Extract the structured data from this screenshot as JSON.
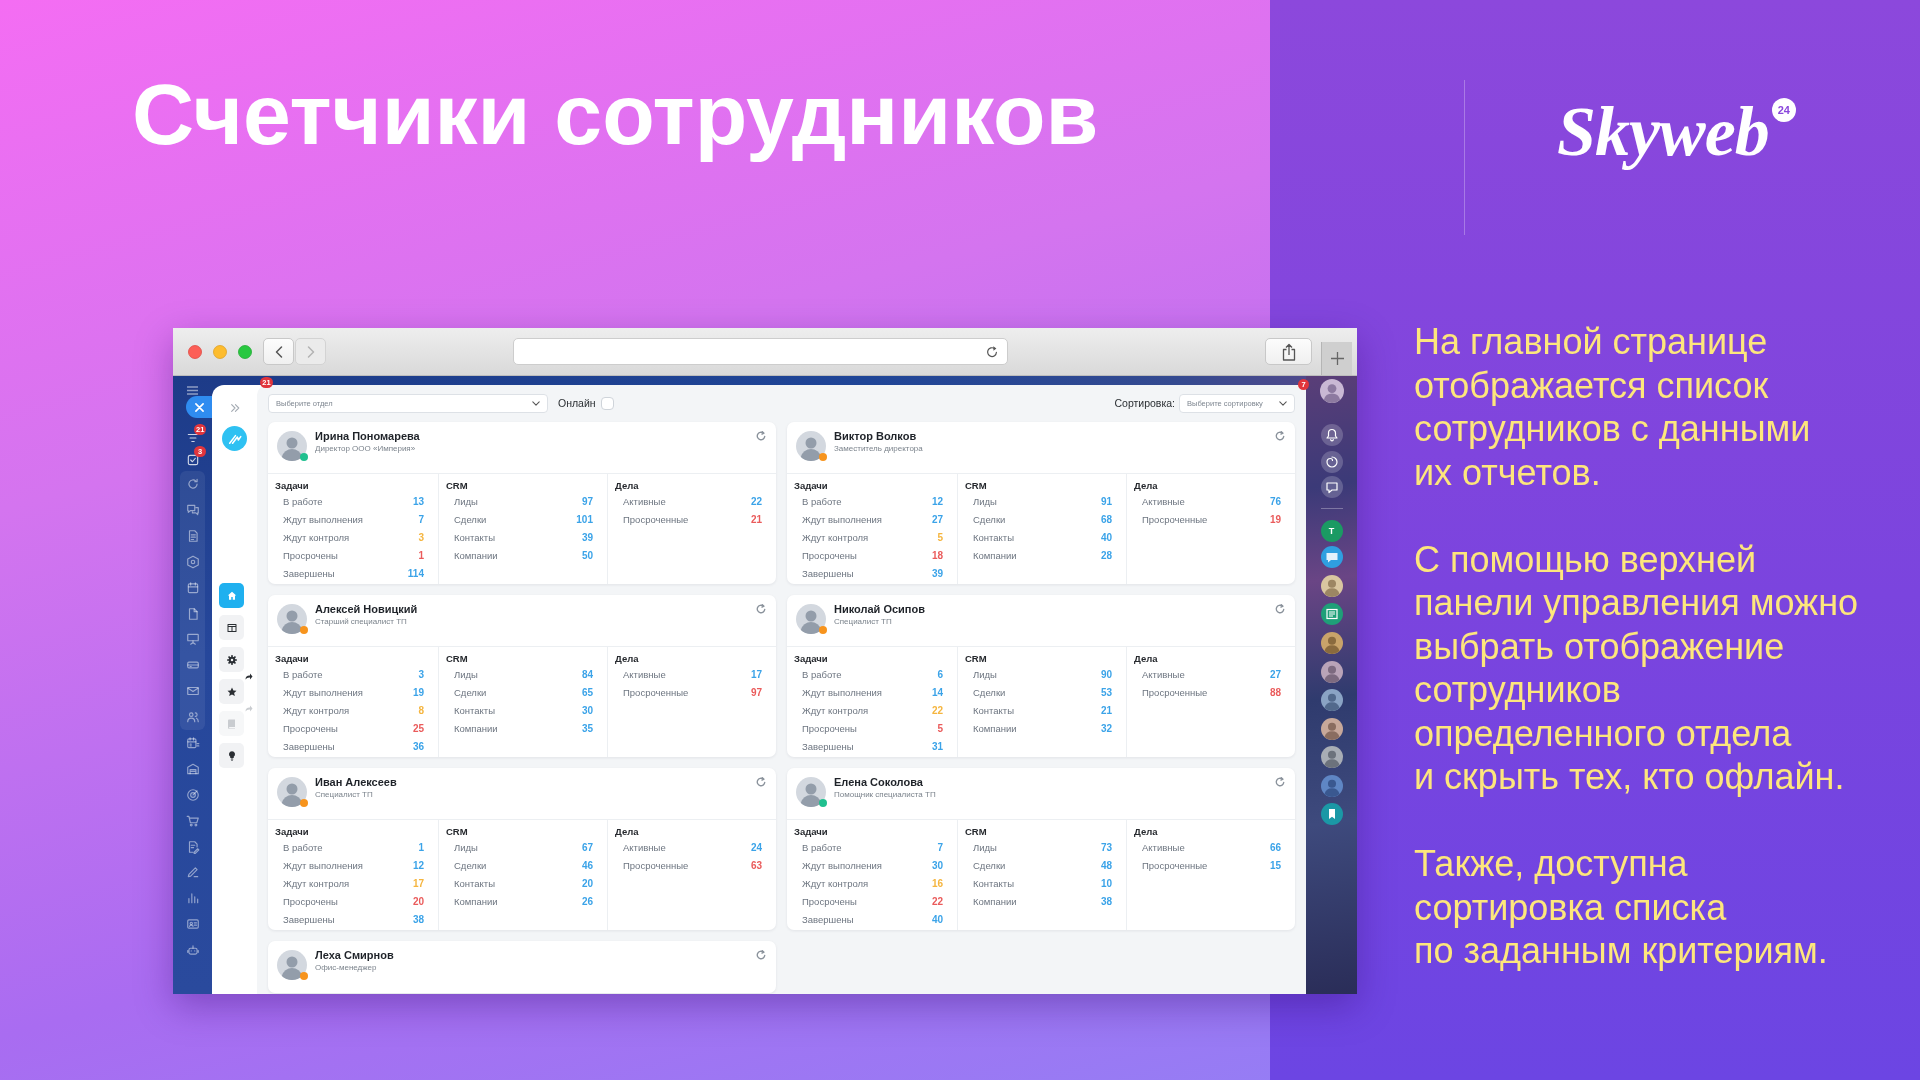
{
  "slide": {
    "title": "Счетчики сотрудников",
    "logo": {
      "text": "Skyweb",
      "badge": "24"
    },
    "paragraphs": [
      "На главной странице\nотображается список\nсотрудников с данными\nих отчетов.",
      "С помощью верхней\nпанели управления можно\nвыбрать отображение\nсотрудников\nопределенного отдела\nи скрыть тех, кто офлайн.",
      "Также, доступна\nсортировка списка\nпо заданным критериям."
    ]
  },
  "browser": {
    "nav_buttons": [
      {
        "disabled": false
      },
      {
        "disabled": true
      }
    ]
  },
  "app": {
    "top_badge": "21",
    "menu_counters": [
      "21",
      "3"
    ],
    "tool_buttons": [
      {
        "selected": true,
        "disabled": false
      },
      {
        "selected": false,
        "disabled": false
      },
      {
        "selected": false,
        "disabled": false
      },
      {
        "selected": false,
        "disabled": false
      },
      {
        "selected": false,
        "disabled": true
      },
      {
        "selected": false,
        "disabled": false
      }
    ],
    "filters": {
      "department": {
        "placeholder": "Выберите отдел"
      },
      "online": {
        "label": "Онлайн",
        "checked": false
      },
      "sort": {
        "label": "Сортировка:",
        "placeholder": "Выберите сортировку"
      }
    },
    "employees": [
      {
        "name": "Ирина Пономарева",
        "position": "Директор ООО «Империя»",
        "status": {
          "color": "#20c08f"
        },
        "sections": [
          {
            "title": "Задачи",
            "rows": [
              {
                "label": "В работе",
                "value": "13",
                "color": "#3ba3e8"
              },
              {
                "label": "Ждут выполнения",
                "value": "7",
                "color": "#3ba3e8"
              },
              {
                "label": "Ждут контроля",
                "value": "3",
                "color": "#f5b53f"
              },
              {
                "label": "Просрочены",
                "value": "1",
                "color": "#ea5b5b"
              },
              {
                "label": "Завершены",
                "value": "114",
                "color": "#3ba3e8"
              }
            ]
          },
          {
            "title": "CRM",
            "rows": [
              {
                "label": "Лиды",
                "value": "97",
                "color": "#3ba3e8"
              },
              {
                "label": "Сделки",
                "value": "101",
                "color": "#3ba3e8"
              },
              {
                "label": "Контакты",
                "value": "39",
                "color": "#3ba3e8"
              },
              {
                "label": "Компании",
                "value": "50",
                "color": "#3ba3e8"
              }
            ]
          },
          {
            "title": "Дела",
            "rows": [
              {
                "label": "Активные",
                "value": "22",
                "color": "#3ba3e8"
              },
              {
                "label": "Просроченные",
                "value": "21",
                "color": "#ea5b5b"
              }
            ]
          }
        ]
      },
      {
        "name": "Виктор Волков",
        "position": "Заместитель директора",
        "status": {
          "color": "#f7941d"
        },
        "sections": [
          {
            "title": "Задачи",
            "rows": [
              {
                "label": "В работе",
                "value": "12",
                "color": "#3ba3e8"
              },
              {
                "label": "Ждут выполнения",
                "value": "27",
                "color": "#3ba3e8"
              },
              {
                "label": "Ждут контроля",
                "value": "5",
                "color": "#f5b53f"
              },
              {
                "label": "Просрочены",
                "value": "18",
                "color": "#ea5b5b"
              },
              {
                "label": "Завершены",
                "value": "39",
                "color": "#3ba3e8"
              }
            ]
          },
          {
            "title": "CRM",
            "rows": [
              {
                "label": "Лиды",
                "value": "91",
                "color": "#3ba3e8"
              },
              {
                "label": "Сделки",
                "value": "68",
                "color": "#3ba3e8"
              },
              {
                "label": "Контакты",
                "value": "40",
                "color": "#3ba3e8"
              },
              {
                "label": "Компании",
                "value": "28",
                "color": "#3ba3e8"
              }
            ]
          },
          {
            "title": "Дела",
            "rows": [
              {
                "label": "Активные",
                "value": "76",
                "color": "#3ba3e8"
              },
              {
                "label": "Просроченные",
                "value": "19",
                "color": "#ea5b5b"
              }
            ]
          }
        ]
      },
      {
        "name": "Алексей Новицкий",
        "position": "Старший специалист ТП",
        "status": {
          "color": "#f7941d"
        },
        "sections": [
          {
            "title": "Задачи",
            "rows": [
              {
                "label": "В работе",
                "value": "3",
                "color": "#3ba3e8"
              },
              {
                "label": "Ждут выполнения",
                "value": "19",
                "color": "#3ba3e8"
              },
              {
                "label": "Ждут контроля",
                "value": "8",
                "color": "#f5b53f"
              },
              {
                "label": "Просрочены",
                "value": "25",
                "color": "#ea5b5b"
              },
              {
                "label": "Завершены",
                "value": "36",
                "color": "#3ba3e8"
              }
            ]
          },
          {
            "title": "CRM",
            "rows": [
              {
                "label": "Лиды",
                "value": "84",
                "color": "#3ba3e8"
              },
              {
                "label": "Сделки",
                "value": "65",
                "color": "#3ba3e8"
              },
              {
                "label": "Контакты",
                "value": "30",
                "color": "#3ba3e8"
              },
              {
                "label": "Компании",
                "value": "35",
                "color": "#3ba3e8"
              }
            ]
          },
          {
            "title": "Дела",
            "rows": [
              {
                "label": "Активные",
                "value": "17",
                "color": "#3ba3e8"
              },
              {
                "label": "Просроченные",
                "value": "97",
                "color": "#ea5b5b"
              }
            ]
          }
        ]
      },
      {
        "name": "Николай Осипов",
        "position": "Специалист ТП",
        "status": {
          "color": "#f7941d"
        },
        "sections": [
          {
            "title": "Задачи",
            "rows": [
              {
                "label": "В работе",
                "value": "6",
                "color": "#3ba3e8"
              },
              {
                "label": "Ждут выполнения",
                "value": "14",
                "color": "#3ba3e8"
              },
              {
                "label": "Ждут контроля",
                "value": "22",
                "color": "#f5b53f"
              },
              {
                "label": "Просрочены",
                "value": "5",
                "color": "#ea5b5b"
              },
              {
                "label": "Завершены",
                "value": "31",
                "color": "#3ba3e8"
              }
            ]
          },
          {
            "title": "CRM",
            "rows": [
              {
                "label": "Лиды",
                "value": "90",
                "color": "#3ba3e8"
              },
              {
                "label": "Сделки",
                "value": "53",
                "color": "#3ba3e8"
              },
              {
                "label": "Контакты",
                "value": "21",
                "color": "#3ba3e8"
              },
              {
                "label": "Компании",
                "value": "32",
                "color": "#3ba3e8"
              }
            ]
          },
          {
            "title": "Дела",
            "rows": [
              {
                "label": "Активные",
                "value": "27",
                "color": "#3ba3e8"
              },
              {
                "label": "Просроченные",
                "value": "88",
                "color": "#ea5b5b"
              }
            ]
          }
        ]
      },
      {
        "name": "Иван Алексеев",
        "position": "Специалист ТП",
        "status": {
          "color": "#f7941d"
        },
        "sections": [
          {
            "title": "Задачи",
            "rows": [
              {
                "label": "В работе",
                "value": "1",
                "color": "#3ba3e8"
              },
              {
                "label": "Ждут выполнения",
                "value": "12",
                "color": "#3ba3e8"
              },
              {
                "label": "Ждут контроля",
                "value": "17",
                "color": "#f5b53f"
              },
              {
                "label": "Просрочены",
                "value": "20",
                "color": "#ea5b5b"
              },
              {
                "label": "Завершены",
                "value": "38",
                "color": "#3ba3e8"
              }
            ]
          },
          {
            "title": "CRM",
            "rows": [
              {
                "label": "Лиды",
                "value": "67",
                "color": "#3ba3e8"
              },
              {
                "label": "Сделки",
                "value": "46",
                "color": "#3ba3e8"
              },
              {
                "label": "Контакты",
                "value": "20",
                "color": "#3ba3e8"
              },
              {
                "label": "Компании",
                "value": "26",
                "color": "#3ba3e8"
              }
            ]
          },
          {
            "title": "Дела",
            "rows": [
              {
                "label": "Активные",
                "value": "24",
                "color": "#3ba3e8"
              },
              {
                "label": "Просроченные",
                "value": "63",
                "color": "#ea5b5b"
              }
            ]
          }
        ]
      },
      {
        "name": "Елена Соколова",
        "position": "Помощник специалиста ТП",
        "status": {
          "color": "#20c08f"
        },
        "sections": [
          {
            "title": "Задачи",
            "rows": [
              {
                "label": "В работе",
                "value": "7",
                "color": "#3ba3e8"
              },
              {
                "label": "Ждут выполнения",
                "value": "30",
                "color": "#3ba3e8"
              },
              {
                "label": "Ждут контроля",
                "value": "16",
                "color": "#f5b53f"
              },
              {
                "label": "Просрочены",
                "value": "22",
                "color": "#ea5b5b"
              },
              {
                "label": "Завершены",
                "value": "40",
                "color": "#3ba3e8"
              }
            ]
          },
          {
            "title": "CRM",
            "rows": [
              {
                "label": "Лиды",
                "value": "73",
                "color": "#3ba3e8"
              },
              {
                "label": "Сделки",
                "value": "48",
                "color": "#3ba3e8"
              },
              {
                "label": "Контакты",
                "value": "10",
                "color": "#3ba3e8"
              },
              {
                "label": "Компании",
                "value": "38",
                "color": "#3ba3e8"
              }
            ]
          },
          {
            "title": "Дела",
            "rows": [
              {
                "label": "Активные",
                "value": "66",
                "color": "#3ba3e8"
              },
              {
                "label": "Просроченные",
                "value": "15",
                "color": "#3ba3e8"
              }
            ]
          }
        ]
      },
      {
        "name": "Леха Смирнов",
        "position": "Офис-менеджер",
        "status": {
          "color": "#f7941d"
        }
      }
    ],
    "right_bar": {
      "badge": "7",
      "chat_letter": "T"
    }
  }
}
